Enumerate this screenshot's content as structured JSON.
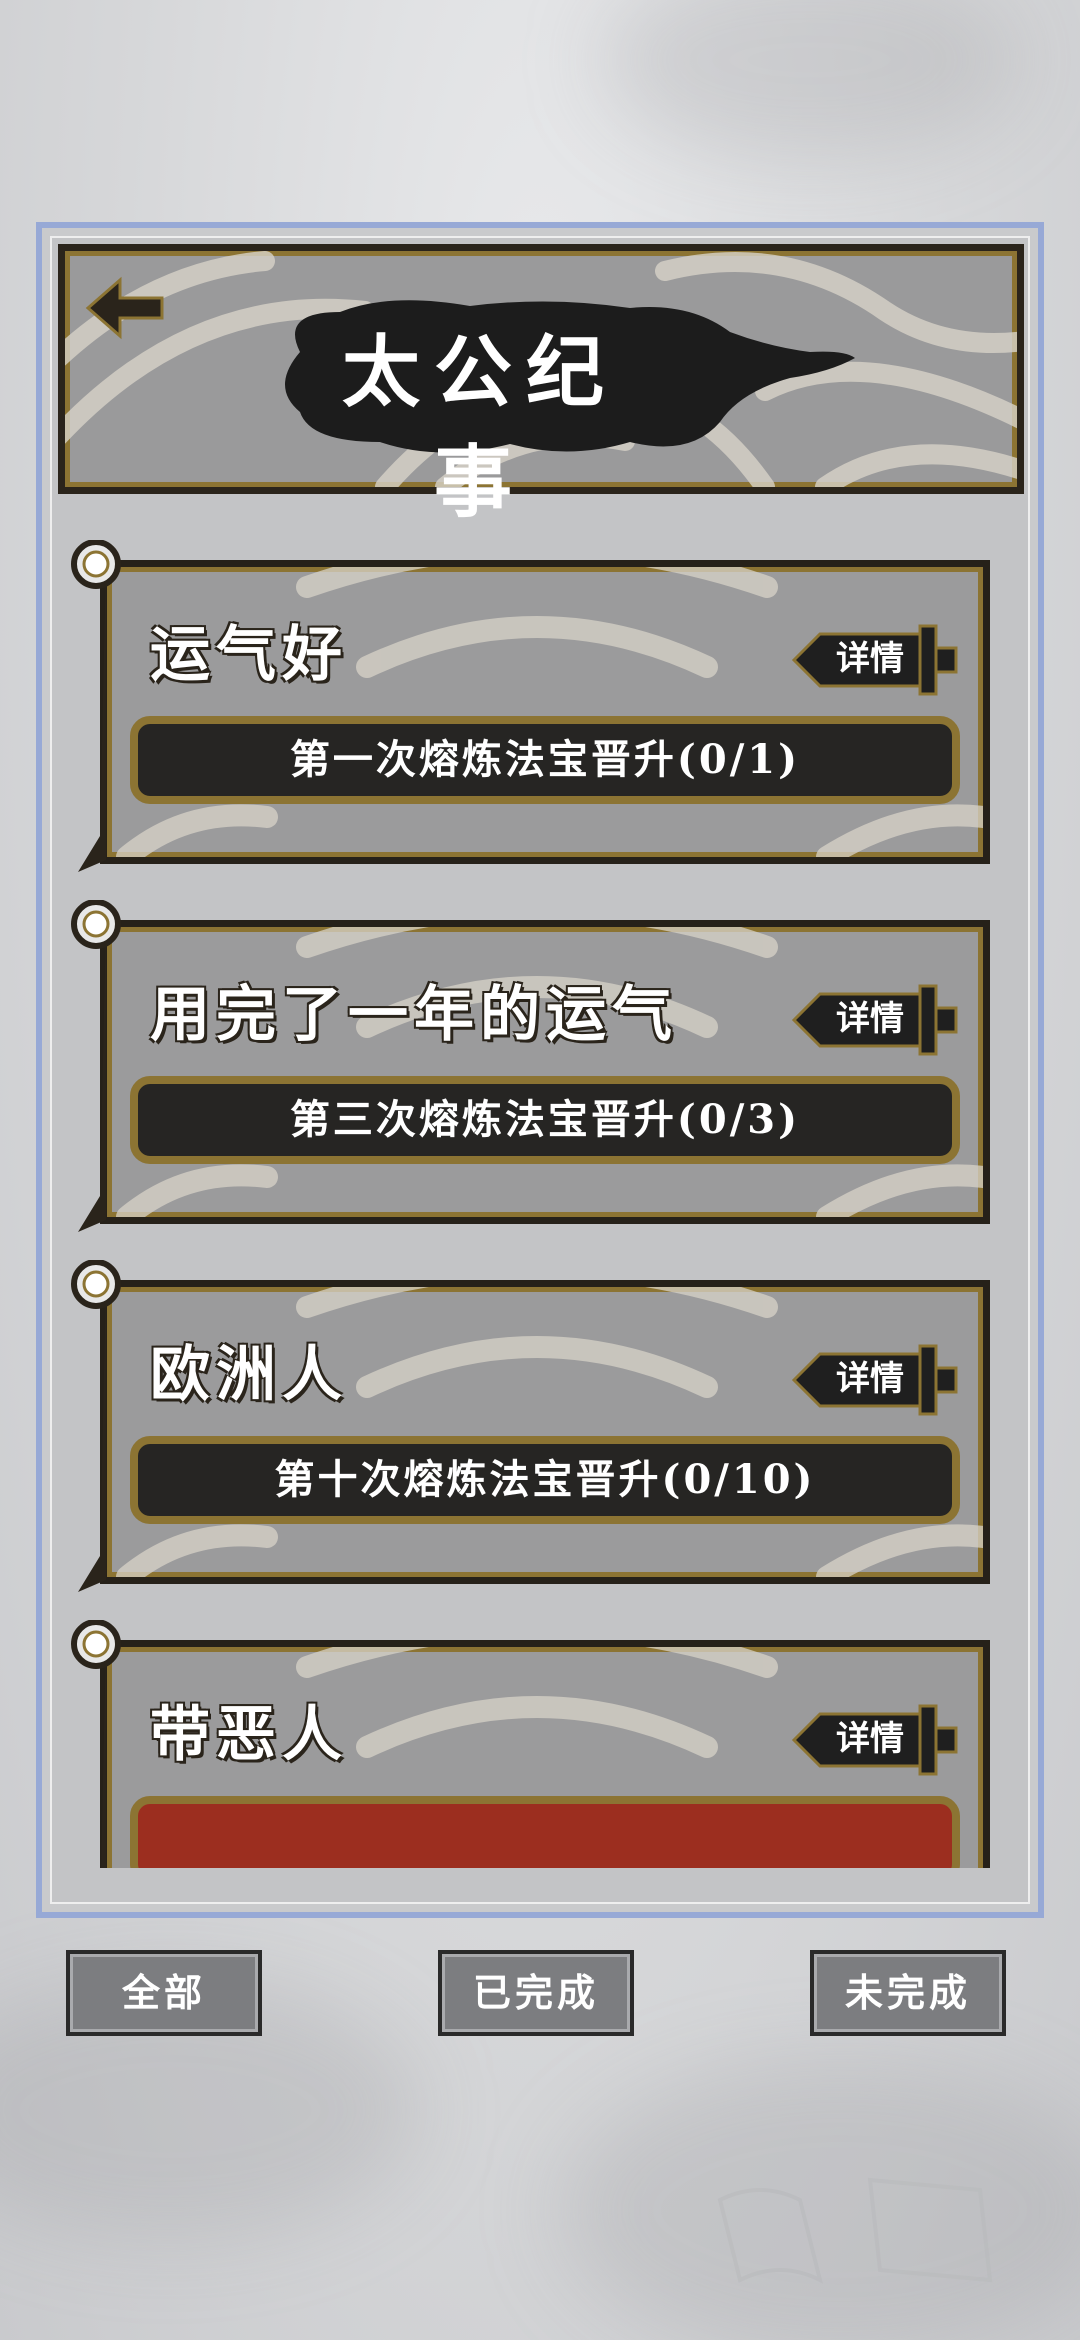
{
  "header": {
    "title": "太公纪事"
  },
  "achievements": [
    {
      "title": "运气好",
      "detail_label": "详情",
      "task": "第一次熔炼法宝晋升(0/1)",
      "task_style": "normal"
    },
    {
      "title": "用完了一年的运气",
      "detail_label": "详情",
      "task": "第三次熔炼法宝晋升(0/3)",
      "task_style": "normal"
    },
    {
      "title": "欧洲人",
      "detail_label": "详情",
      "task": "第十次熔炼法宝晋升(0/10)",
      "task_style": "normal"
    },
    {
      "title": "带恶人",
      "detail_label": "详情",
      "task": "",
      "task_style": "red"
    }
  ],
  "tabs": {
    "all": "全部",
    "completed": "已完成",
    "incomplete": "未完成"
  },
  "colors": {
    "frame_border": "#97a9d6",
    "gold_border": "#8c7433",
    "task_bg": "#262523",
    "task_bg_red": "#9c2e1f"
  }
}
